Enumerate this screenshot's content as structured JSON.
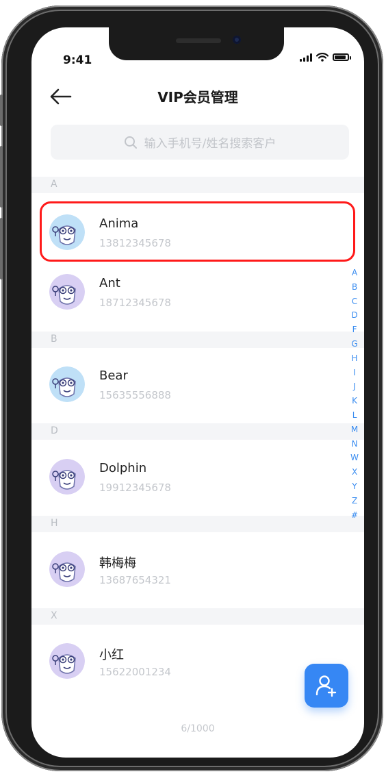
{
  "status_bar": {
    "time": "9:41"
  },
  "header": {
    "title": "VIP会员管理"
  },
  "search": {
    "placeholder": "输入手机号/姓名搜索客户"
  },
  "sections": [
    {
      "letter": "A",
      "contacts": [
        {
          "name": "Anima",
          "phone": "13812345678",
          "avatar_color": "#bfe0f7",
          "selected": true
        },
        {
          "name": "Ant",
          "phone": "18712345678",
          "avatar_color": "#d8cff3"
        }
      ]
    },
    {
      "letter": "B",
      "contacts": [
        {
          "name": "Bear",
          "phone": "15635556888",
          "avatar_color": "#bfe0f7"
        }
      ]
    },
    {
      "letter": "D",
      "contacts": [
        {
          "name": "Dolphin",
          "phone": "19912345678",
          "avatar_color": "#d8cff3"
        }
      ]
    },
    {
      "letter": "H",
      "contacts": [
        {
          "name": "韩梅梅",
          "phone": "13687654321",
          "avatar_color": "#d8cff3"
        }
      ]
    },
    {
      "letter": "X",
      "contacts": [
        {
          "name": "小红",
          "phone": "15622001234",
          "avatar_color": "#d8cff3"
        }
      ]
    }
  ],
  "alphabet_index": [
    "A",
    "B",
    "C",
    "D",
    "F",
    "G",
    "H",
    "I",
    "J",
    "K",
    "L",
    "M",
    "N",
    "W",
    "X",
    "Y",
    "Z",
    "#"
  ],
  "pagination": {
    "text": "6/1000"
  },
  "colors": {
    "accent": "#3687f4",
    "highlight": "#ff1a1a",
    "index": "#3b8df0"
  },
  "icons": {
    "back": "arrow-left-icon",
    "search": "search-icon",
    "add_user": "add-user-icon",
    "avatar": "cartoon-avatar-icon"
  }
}
